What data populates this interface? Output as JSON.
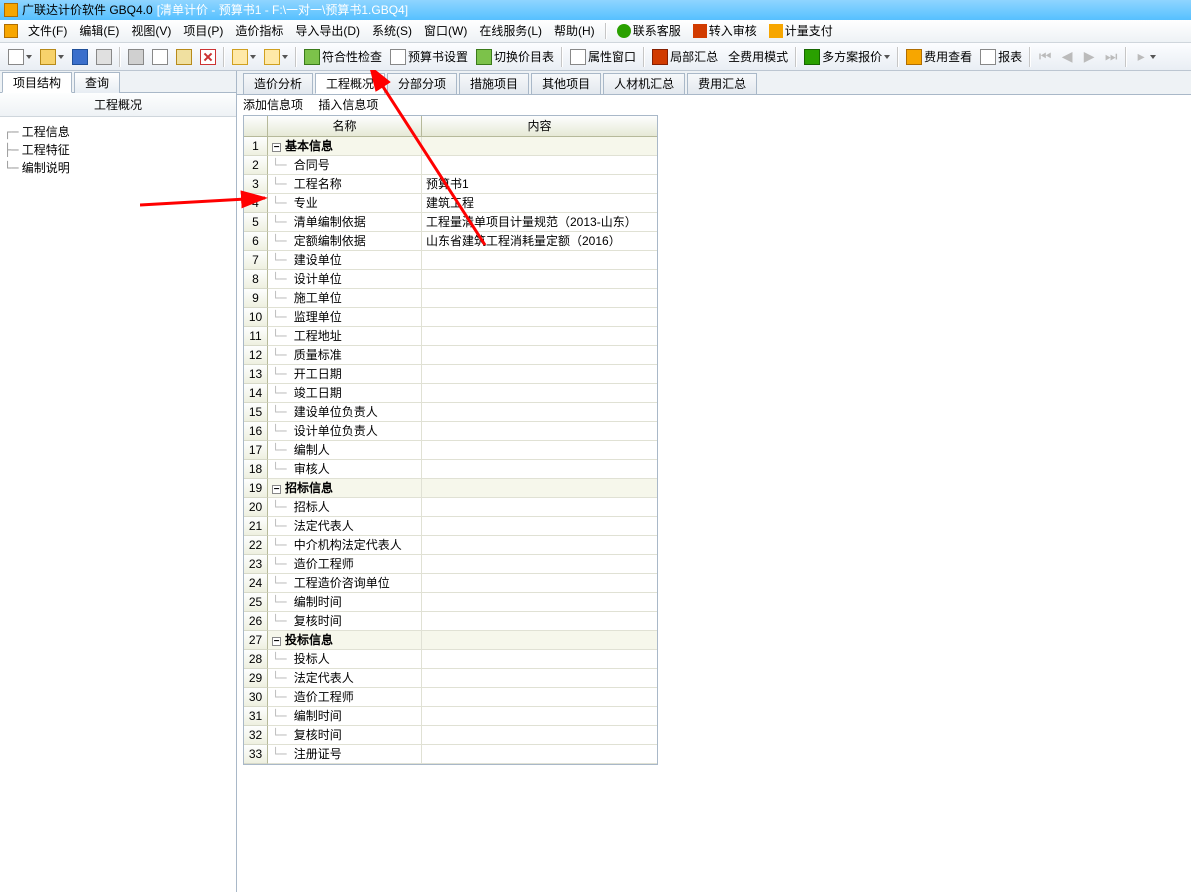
{
  "title": {
    "app": "广联达计价软件 GBQ4.0",
    "mode": "[清单计价 - 预算书1 - F:\\一对一\\预算书1.GBQ4]"
  },
  "menu": {
    "items": [
      "文件(F)",
      "编辑(E)",
      "视图(V)",
      "项目(P)",
      "造价指标",
      "导入导出(D)",
      "系统(S)",
      "窗口(W)",
      "在线服务(L)",
      "帮助(H)"
    ],
    "contact": "联系客服",
    "audit": "转入审核",
    "pay": "计量支付"
  },
  "toolbar": {
    "check": "符合性检查",
    "budget": "预算书设置",
    "switch": "切换价目表",
    "prop": "属性窗口",
    "local_sum": "局部汇总",
    "full_mode": "全费用模式",
    "multi_quote": "多方案报价",
    "cost_view": "费用查看",
    "report": "报表"
  },
  "left": {
    "tabs": [
      "项目结构",
      "查询"
    ],
    "header": "工程概况",
    "tree": [
      "工程信息",
      "工程特征",
      "编制说明"
    ]
  },
  "content_tabs": [
    "造价分析",
    "工程概况",
    "分部分项",
    "措施项目",
    "其他项目",
    "人材机汇总",
    "费用汇总"
  ],
  "sub_actions": [
    "添加信息项",
    "插入信息项"
  ],
  "grid": {
    "col_name": "名称",
    "col_content": "内容",
    "rows": [
      {
        "n": "1",
        "type": "group",
        "name": "基本信息",
        "content": ""
      },
      {
        "n": "2",
        "name": "合同号",
        "content": ""
      },
      {
        "n": "3",
        "name": "工程名称",
        "content": "预算书1"
      },
      {
        "n": "4",
        "name": "专业",
        "content": "建筑工程"
      },
      {
        "n": "5",
        "name": "清单编制依据",
        "content": "工程量清单项目计量规范（2013-山东）"
      },
      {
        "n": "6",
        "name": "定额编制依据",
        "content": "山东省建筑工程消耗量定额（2016）"
      },
      {
        "n": "7",
        "name": "建设单位",
        "content": ""
      },
      {
        "n": "8",
        "name": "设计单位",
        "content": ""
      },
      {
        "n": "9",
        "name": "施工单位",
        "content": ""
      },
      {
        "n": "10",
        "name": "监理单位",
        "content": ""
      },
      {
        "n": "11",
        "name": "工程地址",
        "content": ""
      },
      {
        "n": "12",
        "name": "质量标准",
        "content": ""
      },
      {
        "n": "13",
        "name": "开工日期",
        "content": ""
      },
      {
        "n": "14",
        "name": "竣工日期",
        "content": ""
      },
      {
        "n": "15",
        "name": "建设单位负责人",
        "content": ""
      },
      {
        "n": "16",
        "name": "设计单位负责人",
        "content": ""
      },
      {
        "n": "17",
        "name": "编制人",
        "content": ""
      },
      {
        "n": "18",
        "name": "审核人",
        "content": ""
      },
      {
        "n": "19",
        "type": "group",
        "name": "招标信息",
        "content": ""
      },
      {
        "n": "20",
        "name": "招标人",
        "content": ""
      },
      {
        "n": "21",
        "name": "法定代表人",
        "content": ""
      },
      {
        "n": "22",
        "name": "中介机构法定代表人",
        "content": ""
      },
      {
        "n": "23",
        "name": "造价工程师",
        "content": ""
      },
      {
        "n": "24",
        "name": "工程造价咨询单位",
        "content": ""
      },
      {
        "n": "25",
        "name": "编制时间",
        "content": ""
      },
      {
        "n": "26",
        "name": "复核时间",
        "content": ""
      },
      {
        "n": "27",
        "type": "group",
        "name": "投标信息",
        "content": ""
      },
      {
        "n": "28",
        "name": "投标人",
        "content": ""
      },
      {
        "n": "29",
        "name": "法定代表人",
        "content": ""
      },
      {
        "n": "30",
        "name": "造价工程师",
        "content": ""
      },
      {
        "n": "31",
        "name": "编制时间",
        "content": ""
      },
      {
        "n": "32",
        "name": "复核时间",
        "content": ""
      },
      {
        "n": "33",
        "name": "注册证号",
        "content": ""
      }
    ]
  }
}
